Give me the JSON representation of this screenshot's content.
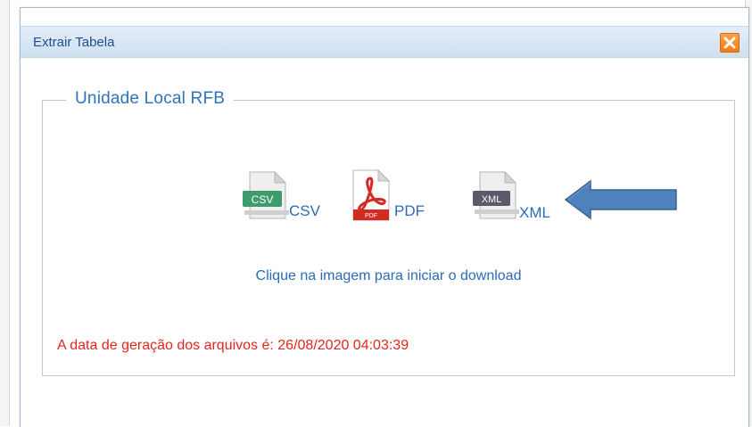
{
  "dialog": {
    "title": "Extrair Tabela",
    "close_icon": "close-x-icon",
    "section": {
      "legend": "Unidade Local RFB",
      "downloads": [
        {
          "badge": "CSV",
          "label": "CSV",
          "icon": "csv-file-icon",
          "badge_color": "#3e9b6c"
        },
        {
          "badge": "PDF",
          "label": "PDF",
          "icon": "pdf-file-icon",
          "badge_color": "#d42a22"
        },
        {
          "badge": "XML",
          "label": "XML",
          "icon": "xml-file-icon",
          "badge_color": "#5a5a6a"
        }
      ],
      "hint": "Clique na imagem para iniciar o download",
      "generation_date": "A data de geração dos arquivos é: 26/08/2020 04:03:39"
    }
  },
  "annotation": {
    "arrow_icon": "blue-left-arrow-icon",
    "arrow_color": "#4f81bd"
  }
}
